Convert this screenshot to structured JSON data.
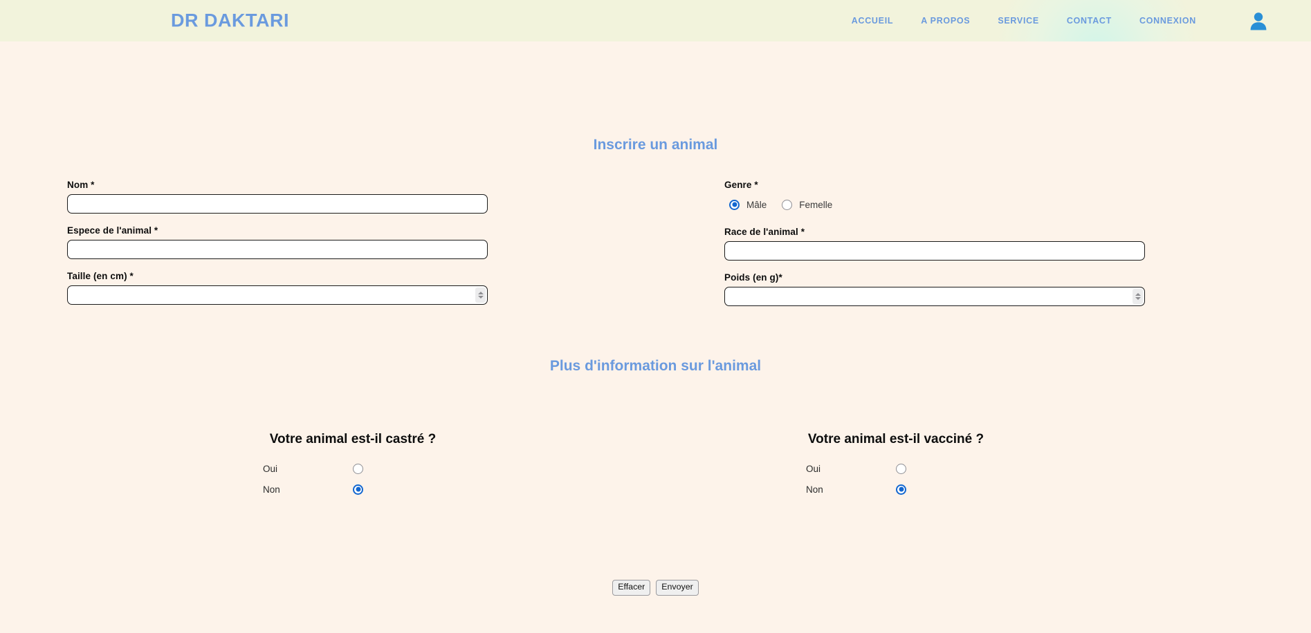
{
  "navbar": {
    "brand": "DR DAKTARI",
    "links": [
      {
        "label": "ACCUEIL"
      },
      {
        "label": "A PROPOS"
      },
      {
        "label": "SERVICE"
      },
      {
        "label": "CONTACT"
      },
      {
        "label": "CONNEXION"
      }
    ],
    "avatar_icon": "user-icon",
    "background_color": "#f2f3dc",
    "link_color": "#6a9ade"
  },
  "page": {
    "background_color": "#fdf3ea",
    "heading_color": "#6a9ade",
    "accent_color": "#1367d0"
  },
  "headings": {
    "inscrire": "Inscrire un animal",
    "plus_info": "Plus d'information sur l'animal"
  },
  "form": {
    "left": {
      "nom": {
        "label": "Nom *",
        "value": "",
        "placeholder": "",
        "type": "text"
      },
      "espece": {
        "label": "Espece de l'animal *",
        "value": "",
        "placeholder": "",
        "type": "text"
      },
      "taille": {
        "label": "Taille (en cm) *",
        "value": "",
        "placeholder": "",
        "type": "number"
      }
    },
    "right": {
      "genre": {
        "label": "Genre *",
        "options": [
          {
            "label": "Mâle",
            "checked": true
          },
          {
            "label": "Femelle",
            "checked": false
          }
        ]
      },
      "race": {
        "label": "Race de l'animal *",
        "value": "",
        "placeholder": "",
        "type": "text"
      },
      "poids": {
        "label": "Poids (en g)*",
        "value": "",
        "placeholder": "",
        "type": "number"
      }
    }
  },
  "questions": [
    {
      "title": "Votre animal est-il castré ?",
      "options": [
        {
          "label": "Oui",
          "checked": false
        },
        {
          "label": "Non",
          "checked": true
        }
      ]
    },
    {
      "title": "Votre animal est-il vacciné ?",
      "options": [
        {
          "label": "Oui",
          "checked": false
        },
        {
          "label": "Non",
          "checked": true
        }
      ]
    }
  ],
  "buttons": {
    "reset": "Effacer",
    "submit": "Envoyer"
  }
}
